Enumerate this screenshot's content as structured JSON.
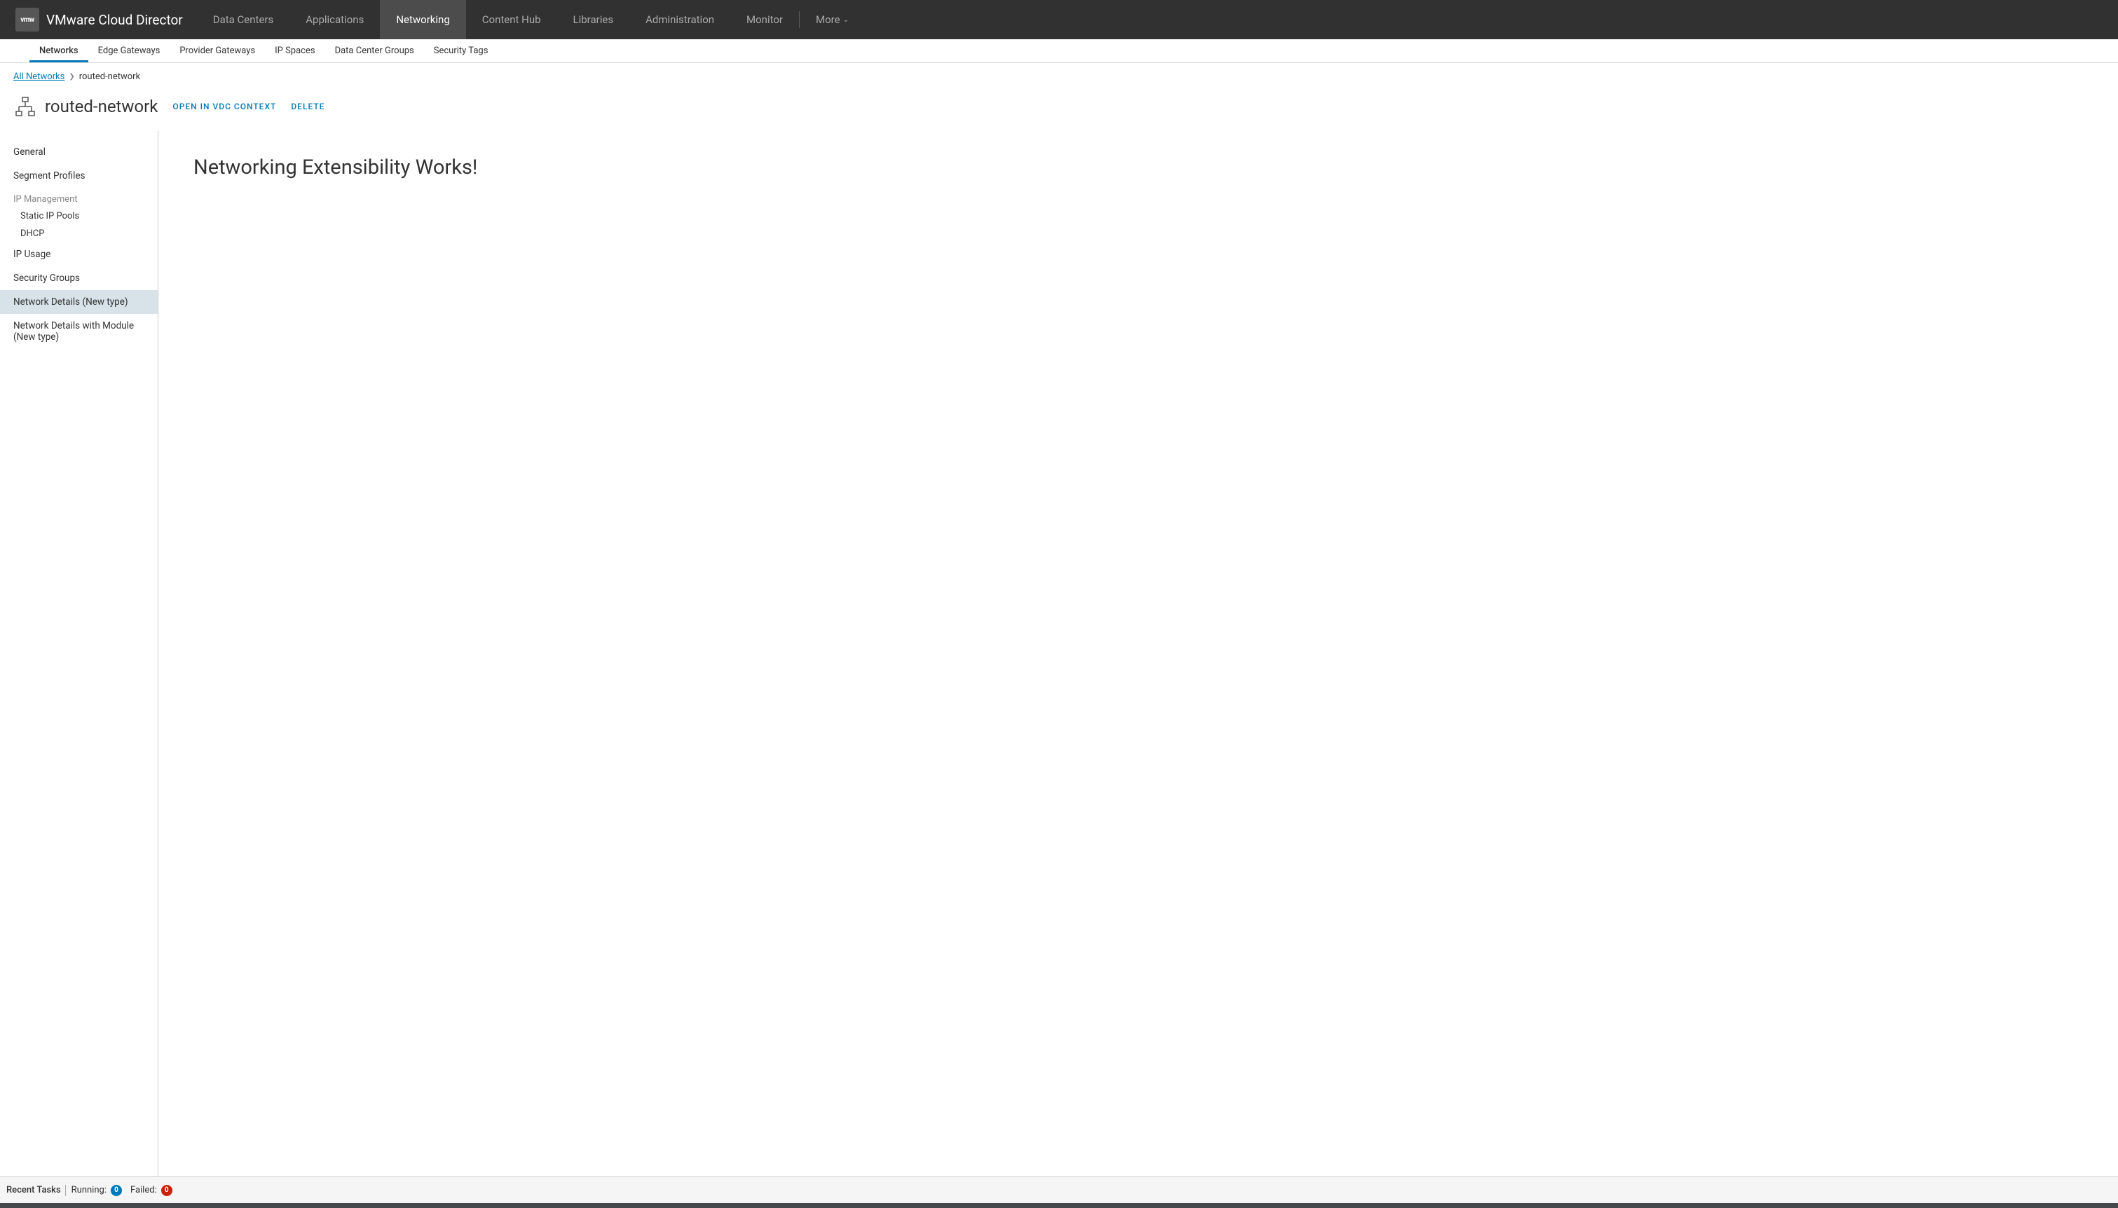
{
  "brand": {
    "logo_text": "vmw",
    "title": "VMware Cloud Director"
  },
  "top_nav": {
    "items": [
      {
        "label": "Data Centers",
        "active": false
      },
      {
        "label": "Applications",
        "active": false
      },
      {
        "label": "Networking",
        "active": true
      },
      {
        "label": "Content Hub",
        "active": false
      },
      {
        "label": "Libraries",
        "active": false
      },
      {
        "label": "Administration",
        "active": false
      },
      {
        "label": "Monitor",
        "active": false
      }
    ],
    "more_label": "More"
  },
  "sub_nav": {
    "items": [
      {
        "label": "Networks",
        "active": true
      },
      {
        "label": "Edge Gateways",
        "active": false
      },
      {
        "label": "Provider Gateways",
        "active": false
      },
      {
        "label": "IP Spaces",
        "active": false
      },
      {
        "label": "Data Center Groups",
        "active": false
      },
      {
        "label": "Security Tags",
        "active": false
      }
    ]
  },
  "breadcrumb": {
    "link_label": "All Networks",
    "current": "routed-network"
  },
  "page": {
    "title": "routed-network",
    "action_open": "OPEN IN VDC CONTEXT",
    "action_delete": "DELETE"
  },
  "sidebar": {
    "general": "General",
    "segment_profiles": "Segment Profiles",
    "ip_management": "IP Management",
    "static_ip_pools": "Static IP Pools",
    "dhcp": "DHCP",
    "ip_usage": "IP Usage",
    "security_groups": "Security Groups",
    "network_details": "Network Details (New type)",
    "network_details_module": "Network Details with Module (New type)"
  },
  "content": {
    "heading": "Networking Extensibility Works!"
  },
  "footer": {
    "recent_tasks": "Recent Tasks",
    "running_label": "Running:",
    "running_count": "0",
    "failed_label": "Failed:",
    "failed_count": "0"
  }
}
